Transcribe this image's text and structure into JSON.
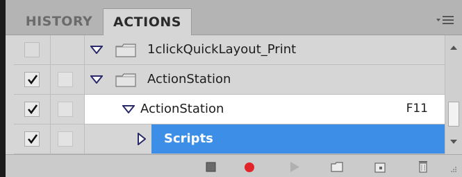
{
  "tabs": [
    {
      "label": "HISTORY",
      "active": false
    },
    {
      "label": "ACTIONS",
      "active": true
    }
  ],
  "panel_menu_icon": "panel-menu-icon",
  "rows": [
    {
      "label": "1clickQuickLayout_Print",
      "type": "set",
      "expanded": true,
      "checked": false,
      "toggle_dialog": false
    },
    {
      "label": "ActionStation",
      "type": "set",
      "expanded": true,
      "checked": true,
      "toggle_dialog": false
    },
    {
      "label": "ActionStation",
      "type": "action",
      "expanded": true,
      "checked": true,
      "toggle_dialog": false,
      "shortcut": "F11"
    },
    {
      "label": "Scripts",
      "type": "step",
      "expanded": false,
      "checked": true,
      "toggle_dialog": false,
      "selected": true
    }
  ],
  "toolbar": {
    "buttons": [
      "stop-icon",
      "record-icon",
      "play-icon",
      "new-set-icon",
      "new-action-icon",
      "trash-icon"
    ]
  },
  "colors": {
    "selection": "#3d8ee6",
    "record": "#e0242a",
    "panel": "#d6d6d6",
    "tabbar": "#b4b4b4"
  }
}
